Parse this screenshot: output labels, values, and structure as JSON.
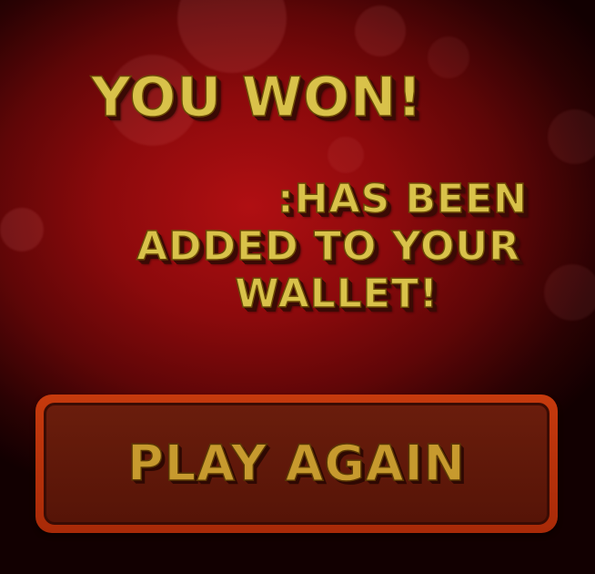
{
  "result": {
    "title": "YOU WON!",
    "message_lines": [
      ":HAS BEEN",
      "ADDED TO YOUR",
      "WALLET!"
    ]
  },
  "actions": {
    "play_again_label": "PLAY AGAIN"
  },
  "colors": {
    "background": "#8c0a0c",
    "text_gold": "#d9c24a",
    "text_shadow": "#3a0a05",
    "button_border": "#c63a0d",
    "button_fill": "#6a1d0c",
    "button_text": "#c79a2e"
  }
}
